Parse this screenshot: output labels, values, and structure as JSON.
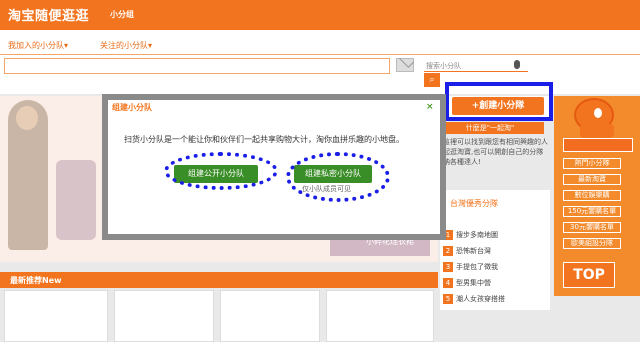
{
  "header": {
    "logo": "淘宝随便逛逛",
    "link": "小分组"
  },
  "subnav": {
    "tab_joined": "我加入的小分队▾",
    "tab_followed": "关注的小分队▾"
  },
  "search": {
    "placeholder": "搜索小分队"
  },
  "actions": {
    "create_label": "+創建小分隊",
    "what_is": "什麽是\"一起淘\""
  },
  "description": "在這裡可以找到跟您有相同興趣的人一起逛淘寶,也可以開創自己的分隊廣納各種達人!",
  "banner": {
    "caption": "小碎花连衣裙"
  },
  "sidebar": {
    "buttons": [
      "熱門小分隊",
      "最新淘寶",
      "數位娛樂購",
      "150元饗購名單",
      "30元饗購名單",
      "歐美組設分隊"
    ],
    "top": "TOP"
  },
  "list": {
    "title": "台灣優秀分隊",
    "items": [
      "搜步多南地圖",
      "恐怖新台灣",
      "手提包了徵我",
      "型男集中營",
      "潮人女孩穿搭搭"
    ]
  },
  "new_section": {
    "label": "最新推荐New"
  },
  "dialog": {
    "title": "组建小分队",
    "close": "×",
    "text": "扫货小分队是一个能让你和伙伴们一起共享购物大计，淘你血拼乐趣的小地盘。",
    "public_label": "组建公开小分队",
    "private_label": "组建私密小分队",
    "private_note": "仅小队成员可见"
  }
}
